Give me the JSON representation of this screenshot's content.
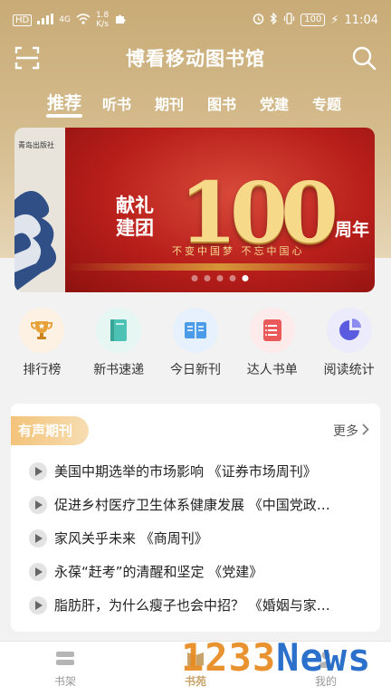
{
  "status_bar": {
    "left_badge": "HD",
    "signal_label": "4G",
    "speed_value": "1.8",
    "speed_unit": "K/s",
    "battery": "100",
    "time": "11:04"
  },
  "header": {
    "title": "博看移动图书馆"
  },
  "tabs": [
    {
      "label": "推荐",
      "active": true
    },
    {
      "label": "听书",
      "active": false
    },
    {
      "label": "期刊",
      "active": false
    },
    {
      "label": "图书",
      "active": false
    },
    {
      "label": "党建",
      "active": false
    },
    {
      "label": "专题",
      "active": false
    }
  ],
  "banner": {
    "publisher": "青岛出版社",
    "left_line1": "献礼",
    "left_line2": "建团",
    "big_number": "100",
    "right_text": "周年",
    "slogan": "不变中国梦 不忘中国心",
    "dot_count": 5,
    "active_dot": 4
  },
  "quick_entries": [
    {
      "label": "排行榜",
      "icon": "trophy-icon",
      "color": "#e8a23a"
    },
    {
      "label": "新书速递",
      "icon": "book-icon",
      "color": "#4cc2b4"
    },
    {
      "label": "今日新刊",
      "icon": "open-book-icon",
      "color": "#4b9be8"
    },
    {
      "label": "达人书单",
      "icon": "list-icon",
      "color": "#ea5a5a"
    },
    {
      "label": "阅读统计",
      "icon": "pie-chart-icon",
      "color": "#5b5be0"
    }
  ],
  "audio_section": {
    "title": "有声期刊",
    "more_label": "更多",
    "items": [
      {
        "text": "美国中期选举的市场影响 《证券市场周刊》"
      },
      {
        "text": "促进乡村医疗卫生体系健康发展 《中国党政…"
      },
      {
        "text": "家风关乎未来 《商周刊》"
      },
      {
        "text": "永葆“赶考”的清醒和坚定 《党建》"
      },
      {
        "text": "脂肪肝，为什么瘦子也会中招？ 《婚姻与家…"
      }
    ]
  },
  "tabbar": {
    "items": [
      {
        "label": "书架",
        "icon": "bookshelf-icon"
      },
      {
        "label": "书苑",
        "icon": "book-garden-icon",
        "active": true
      },
      {
        "label": "我的",
        "icon": "profile-icon"
      }
    ]
  },
  "watermark": {
    "digits": "1233",
    "text": "News"
  },
  "colors": {
    "header_gold": "#c8ab77",
    "accent_gold": "#c8a46a",
    "banner_red": "#b81e1a"
  }
}
